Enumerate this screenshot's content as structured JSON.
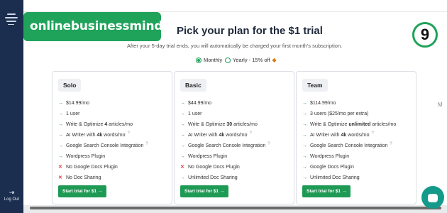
{
  "sidebar": {
    "logout_label": "Log Out",
    "logout_icon": "logout-icon",
    "logo_icon": "app-logo-icon"
  },
  "brand": "onlinebusinessmind.net",
  "badge": "9",
  "header": {
    "title": "Pick your plan for the $1 trial",
    "subtitle": "After your 5-day trial ends, you will automatically be charged your first month's subscription."
  },
  "billing": {
    "monthly": "Monthly",
    "yearly": "Yearly - 15% off",
    "selected": "Monthly"
  },
  "plans": [
    {
      "name": "Solo",
      "price": "$14.99/mo",
      "features": [
        {
          "text": "1 user",
          "included": true
        },
        {
          "text": "Write & Optimize 4 articles/mo",
          "included": true
        },
        {
          "text": "AI Writer with 4k words/mo",
          "included": true,
          "help": "?"
        },
        {
          "text": "Google Search Console Integration",
          "included": true,
          "help": "?"
        },
        {
          "text": "Wordpress Plugin",
          "included": true
        },
        {
          "text": "No Google Docs Plugin",
          "included": false
        },
        {
          "text": "No Doc Sharing",
          "included": false
        }
      ],
      "cta": "Start trial for $1 →"
    },
    {
      "name": "Basic",
      "price": "$44.99/mo",
      "features": [
        {
          "text": "1 user",
          "included": true
        },
        {
          "text": "Write & Optimize 30 articles/mo",
          "included": true
        },
        {
          "text": "AI Writer with 4k words/mo",
          "included": true,
          "help": "?"
        },
        {
          "text": "Google Search Console Integration",
          "included": true,
          "help": "?"
        },
        {
          "text": "Wordpress Plugin",
          "included": true
        },
        {
          "text": "No Google Docs Plugin",
          "included": false
        },
        {
          "text": "Unlimited Doc Sharing",
          "included": true
        }
      ],
      "cta": "Start trial for $1 →"
    },
    {
      "name": "Team",
      "price": "$114.99/mo",
      "features": [
        {
          "text": "3 users ($25/mo per extra)",
          "included": true
        },
        {
          "text": "Write & Optimize unlimited articles/mo",
          "included": true
        },
        {
          "text": "AI Writer with 4k words/mo",
          "included": true,
          "help": "?"
        },
        {
          "text": "Google Search Console Integration",
          "included": true,
          "help": "?"
        },
        {
          "text": "Wordpress Plugin",
          "included": true
        },
        {
          "text": "Google Docs Plugin",
          "included": true
        },
        {
          "text": "Unlimited Doc Sharing",
          "included": true
        }
      ],
      "cta": "Start trial for $1 →"
    }
  ],
  "icons": {
    "check": "→",
    "cross": "✕"
  },
  "colors": {
    "brand": "#1fa35a",
    "sidebar": "#1c2e4f",
    "cross": "#e03b3b",
    "chat": "#149a8a"
  },
  "side_tab": "M"
}
